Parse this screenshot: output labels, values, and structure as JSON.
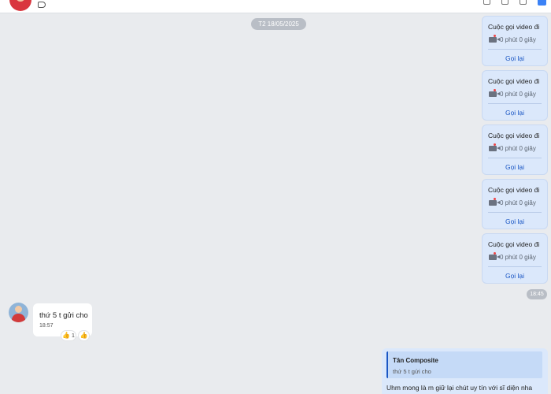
{
  "header": {
    "avatar_icon": "user-avatar-icon",
    "tag_icon": "label-tag-icon"
  },
  "date_separator": "T2 18/05/2025",
  "call_cards": [
    {
      "title": "Cuộc gọi video đi",
      "duration": "0 phút 0 giây",
      "action": "Gọi lại"
    },
    {
      "title": "Cuộc gọi video đi",
      "duration": "0 phút 0 giây",
      "action": "Gọi lại"
    },
    {
      "title": "Cuộc gọi video đi",
      "duration": "0 phút 0 giây",
      "action": "Gọi lại"
    },
    {
      "title": "Cuộc gọi video đi",
      "duration": "0 phút 0 giây",
      "action": "Gọi lại"
    },
    {
      "title": "Cuộc gọi video đi",
      "duration": "0 phút 0 giây",
      "action": "Gọi lại"
    }
  ],
  "calls_time": "18:45",
  "incoming_message": {
    "text": "thứ 5 t gửi cho",
    "time": "18:57",
    "reaction_count": "1",
    "reaction_icon": "thumbs-up-icon"
  },
  "reply_message": {
    "quote_author": "Tân Composite",
    "quote_text": "thứ 5 t gửi cho",
    "text": "Uhm mong là m giữ lại chút uy tín với sĩ diện nha"
  },
  "colors": {
    "background": "#e9ebee",
    "sent_bubble": "#dbe8fb",
    "accent": "#1a56c4"
  }
}
